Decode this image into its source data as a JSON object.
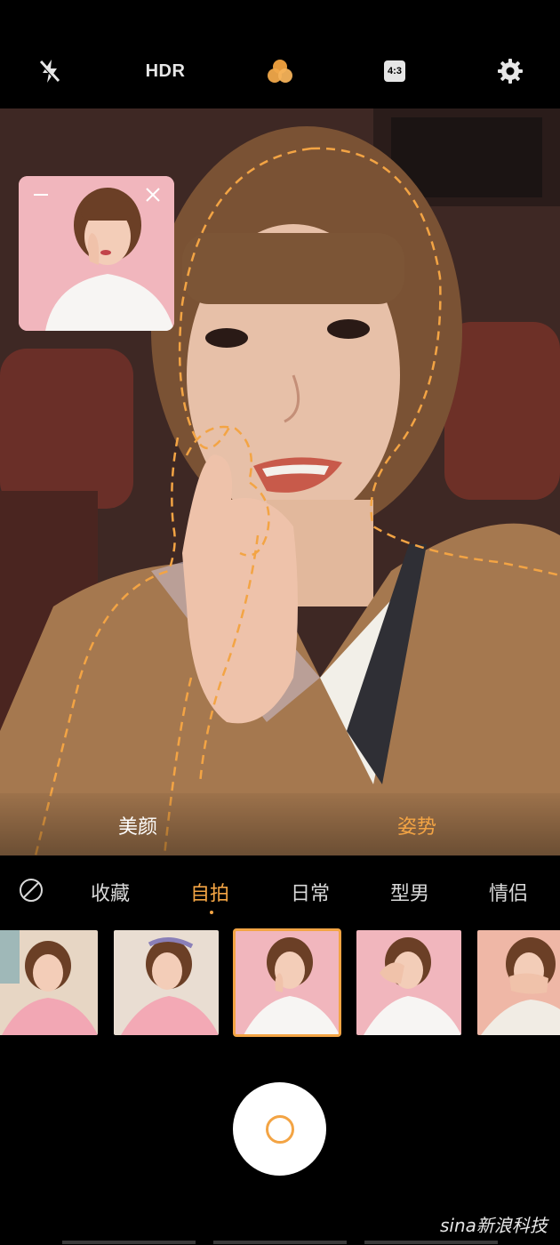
{
  "topbar": {
    "flash_icon": "flash-off-icon",
    "hdr_label": "HDR",
    "filter_icon": "filter-circles-icon",
    "ratio_label": "4:3",
    "settings_icon": "gear-icon"
  },
  "viewfinder": {
    "pose_preview": {
      "minimize_icon": "minimize-icon",
      "close_icon": "close-icon"
    },
    "modes": {
      "beauty": "美颜",
      "pose": "姿势"
    }
  },
  "tabs": {
    "none_icon": "none-slash-icon",
    "items": [
      "收藏",
      "自拍",
      "日常",
      "型男",
      "情侣"
    ],
    "active_index": 1
  },
  "thumbnails": {
    "count": 5,
    "selected_index": 2
  },
  "shutter": {
    "icon": "shutter-ring-icon"
  },
  "watermark": "sina新浪科技",
  "colors": {
    "accent": "#f3a444",
    "background": "#000000"
  }
}
